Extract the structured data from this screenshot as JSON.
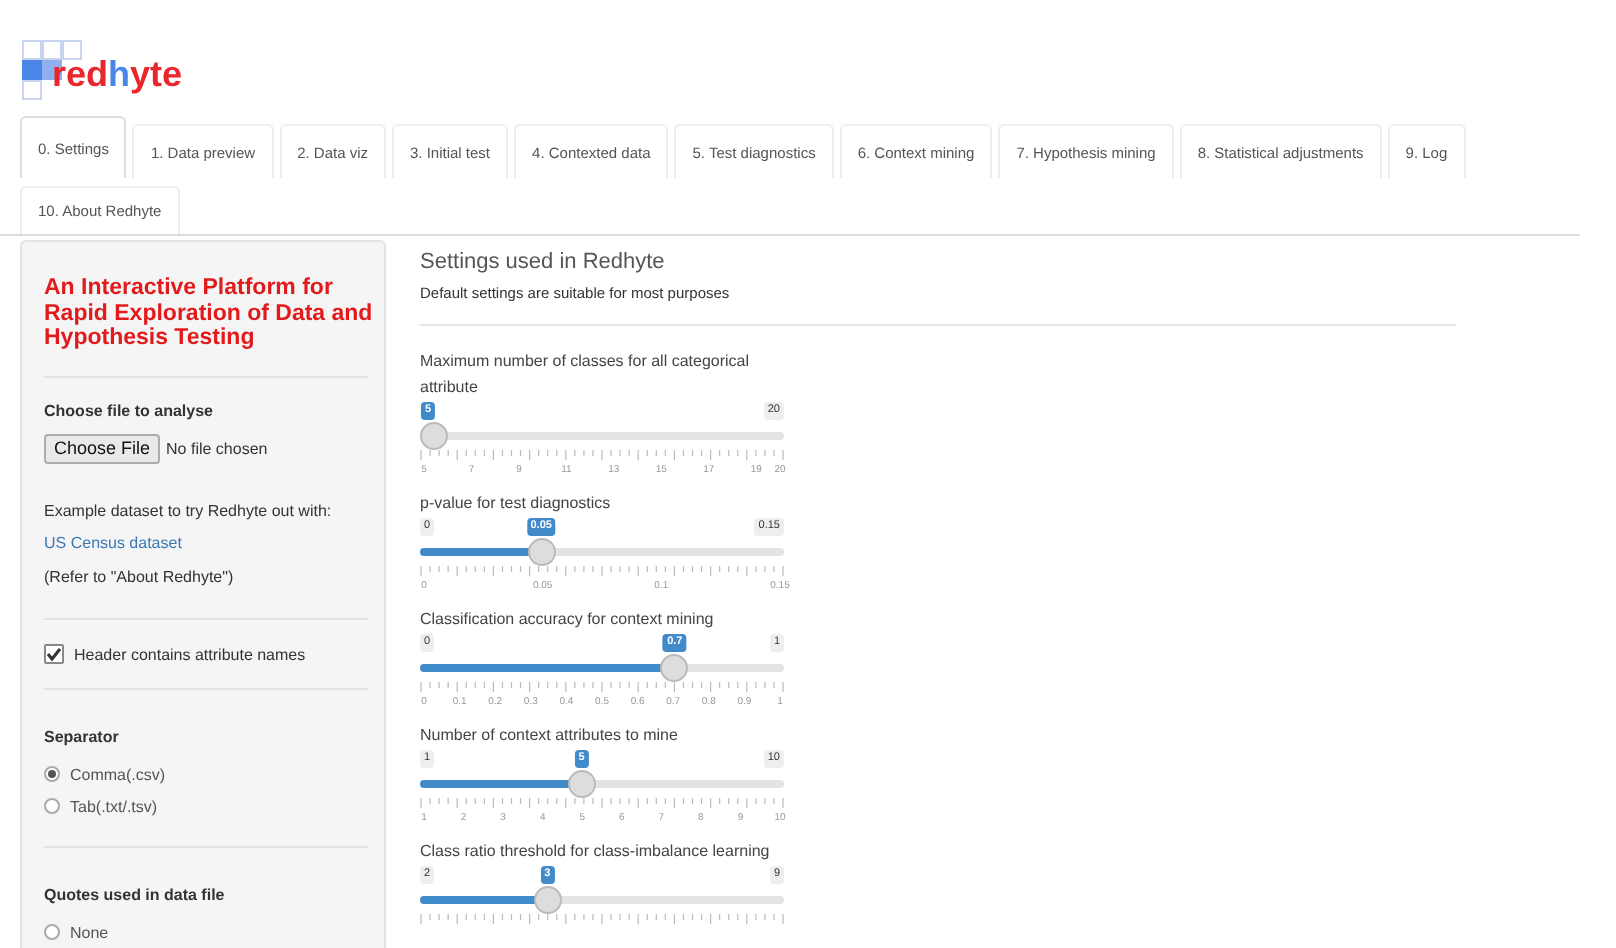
{
  "logo": {
    "parts": [
      {
        "text": "red",
        "color": "#e8262c"
      },
      {
        "text": "h",
        "color": "#4a86e8"
      },
      {
        "text": "yte",
        "color": "#e8262c"
      }
    ]
  },
  "tabs": [
    {
      "label": "0. Settings",
      "selected": true
    },
    {
      "label": "1. Data preview",
      "selected": false
    },
    {
      "label": "2. Data viz",
      "selected": false
    },
    {
      "label": "3. Initial test",
      "selected": false
    },
    {
      "label": "4. Contexted data",
      "selected": false
    },
    {
      "label": "5. Test diagnostics",
      "selected": false
    },
    {
      "label": "6. Context mining",
      "selected": false
    },
    {
      "label": "7. Hypothesis mining",
      "selected": false
    },
    {
      "label": "8. Statistical adjustments",
      "selected": false
    },
    {
      "label": "9. Log",
      "selected": false
    },
    {
      "label": "10. About Redhyte",
      "selected": false
    }
  ],
  "sidebar": {
    "title": "An Interactive Platform for Rapid Exploration of Data and Hypothesis Testing",
    "file": {
      "label": "Choose file to analyse",
      "button": "Choose File",
      "status": "No file chosen"
    },
    "example": {
      "text": "Example dataset to try Redhyte out with:",
      "link": "US Census dataset",
      "note": "(Refer to \"About Redhyte\")"
    },
    "header_checkbox": {
      "label": "Header contains attribute names",
      "checked": true
    },
    "separator": {
      "label": "Separator",
      "options": [
        {
          "label": "Comma(.csv)",
          "selected": true
        },
        {
          "label": "Tab(.txt/.tsv)",
          "selected": false
        }
      ]
    },
    "quotes": {
      "label": "Quotes used in data file",
      "options": [
        {
          "label": "None",
          "selected": false
        }
      ]
    }
  },
  "main": {
    "title": "Settings used in Redhyte",
    "subtitle": "Default settings are suitable for most purposes",
    "sliders": [
      {
        "label": "Maximum number of classes for all categorical attribute",
        "max": "20",
        "value": "5",
        "level": 0,
        "ticks": [
          "5",
          "7",
          "9",
          "11",
          "13",
          "15",
          "17",
          "19",
          "20"
        ]
      },
      {
        "label": "p-value for test diagnostics",
        "min": "0",
        "max": "0.15",
        "value": "0.05",
        "level": 0.333,
        "ticks": [
          "0",
          "0.05",
          "0.1",
          "0.15"
        ]
      },
      {
        "label": "Classification accuracy for context mining",
        "min": "0",
        "max": "1",
        "value": "0.7",
        "level": 0.7,
        "ticks": [
          "0",
          "0.1",
          "0.2",
          "0.3",
          "0.4",
          "0.5",
          "0.6",
          "0.7",
          "0.8",
          "0.9",
          "1"
        ]
      },
      {
        "label": "Number of context attributes to mine",
        "min": "1",
        "max": "10",
        "value": "5",
        "level": 0.444,
        "ticks": [
          "1",
          "2",
          "3",
          "4",
          "5",
          "6",
          "7",
          "8",
          "9",
          "10"
        ]
      },
      {
        "label": "Class ratio threshold for class-imbalance learning",
        "min": "2",
        "max": "9",
        "value": "3",
        "level": 0.35
      }
    ]
  }
}
